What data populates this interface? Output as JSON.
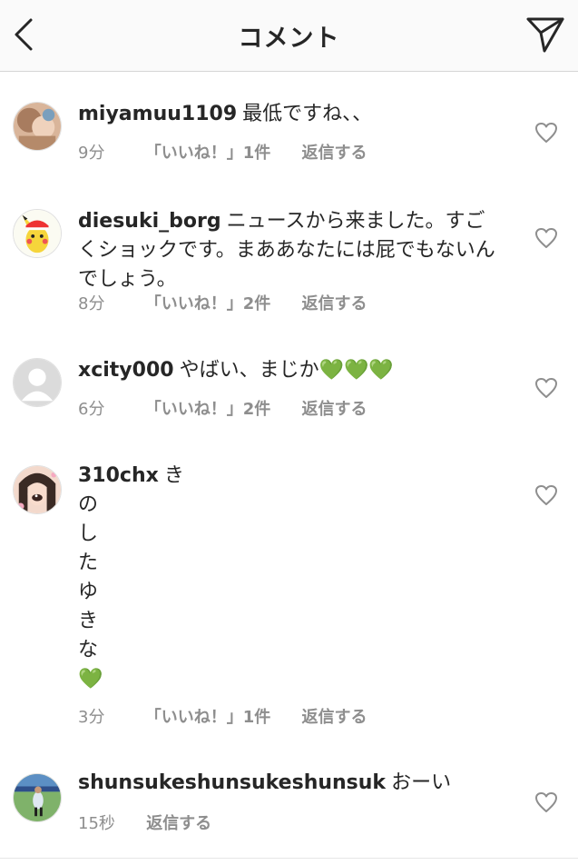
{
  "header": {
    "title": "コメント",
    "back_icon": "chevron-left-icon",
    "send_icon": "paper-plane-icon"
  },
  "comments": [
    {
      "username": "miyamuu1109",
      "text": "最低ですね、、",
      "time": "9分",
      "likes": "「いいね！」1件",
      "reply": "返信する"
    },
    {
      "username": "diesuki_borg",
      "text": "ニュースから来ました。すごくショックです。まああなたには屁でもないんでしょう。",
      "time": "8分",
      "likes": "「いいね！」2件",
      "reply": "返信する"
    },
    {
      "username": "xcity000",
      "text": "やばい、まじか💚💚💚",
      "time": "6分",
      "likes": "「いいね！」2件",
      "reply": "返信する"
    },
    {
      "username": "310chx",
      "text": "き\nの\nし\nた\nゆ\nき\nな\n💚",
      "time": "3分",
      "likes": "「いいね！」1件",
      "reply": "返信する"
    },
    {
      "username": "shunsukeshunsukeshunsuk",
      "text": "おーい",
      "time": "15秒",
      "reply": "返信する"
    }
  ],
  "colors": {
    "text": "#262626",
    "meta": "#8e8e8e",
    "header_bg": "#fafafa",
    "heart_green": "#3ccf3c"
  }
}
